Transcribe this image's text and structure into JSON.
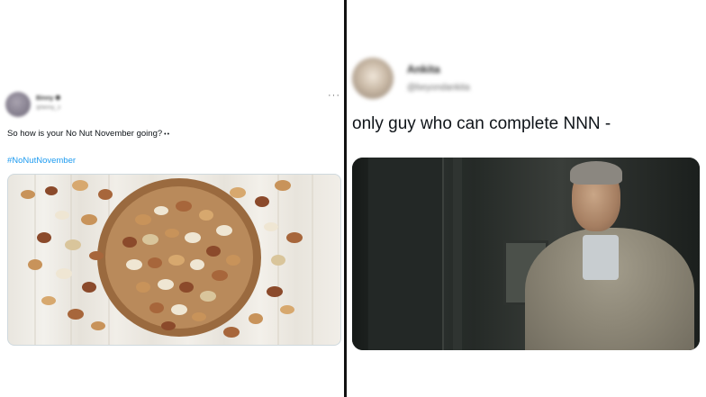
{
  "left_tweet": {
    "display_name": "Binny ❁",
    "handle": "@binny_3",
    "more_label": "···",
    "text": "So how is your No Nut November going?",
    "emoji": "••",
    "hashtag": "#NoNutNovember",
    "media_icon": "bowl-of-mixed-nuts-photo"
  },
  "right_tweet": {
    "display_name": "Ankita",
    "handle": "@beyondankita",
    "text": "only guy who can complete NNN -",
    "media_icon": "man-in-shawl-movie-still"
  }
}
